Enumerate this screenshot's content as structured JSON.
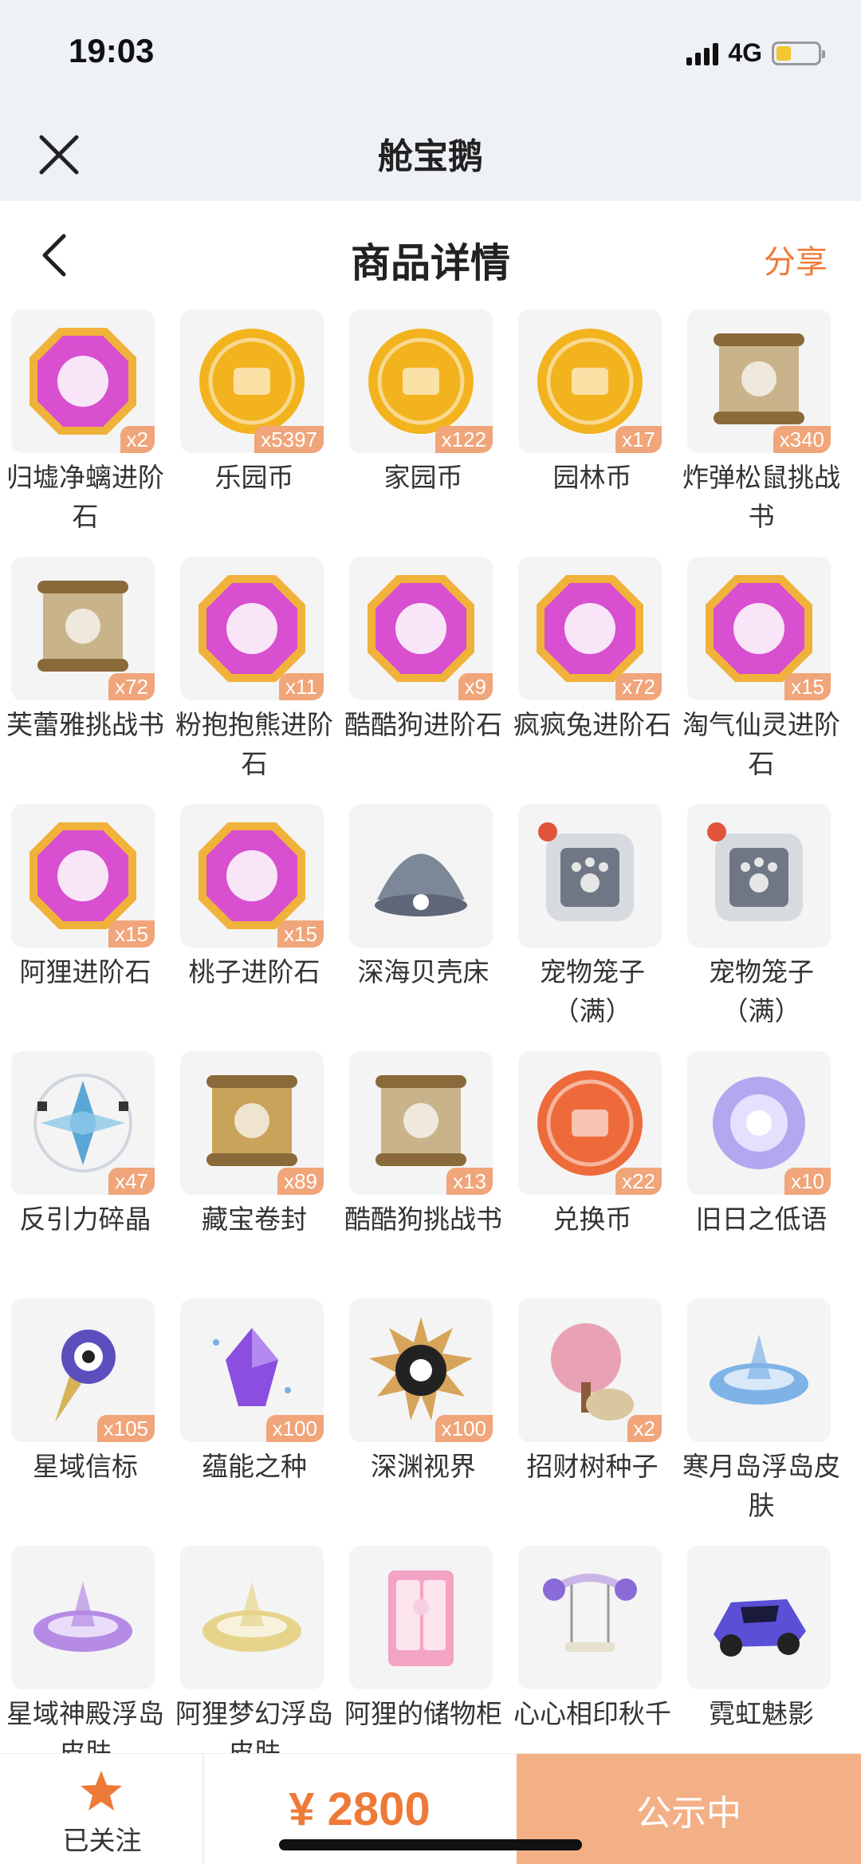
{
  "status": {
    "time": "19:03",
    "network": "4G"
  },
  "app": {
    "title": "舱宝鹅"
  },
  "page": {
    "title": "商品详情",
    "share": "分享"
  },
  "items": [
    {
      "name": "归墟净螭进阶石",
      "qty": "x2",
      "icon": "gem-icon",
      "color": "#d84fd0"
    },
    {
      "name": "乐园币",
      "qty": "x5397",
      "icon": "coin-icon",
      "color": "#f2b31f"
    },
    {
      "name": "家园币",
      "qty": "x122",
      "icon": "coin-icon",
      "color": "#f2b31f"
    },
    {
      "name": "园林币",
      "qty": "x17",
      "icon": "coin-icon",
      "color": "#f2b31f"
    },
    {
      "name": "炸弹松鼠挑战书",
      "qty": "x340",
      "icon": "scroll-icon",
      "color": "#c9b38a"
    },
    {
      "name": "芙蕾雅挑战书",
      "qty": "x72",
      "icon": "scroll-icon",
      "color": "#c9b38a"
    },
    {
      "name": "粉抱抱熊进阶石",
      "qty": "x11",
      "icon": "gem-icon",
      "color": "#d84fd0"
    },
    {
      "name": "酷酷狗进阶石",
      "qty": "x9",
      "icon": "gem-icon",
      "color": "#d84fd0"
    },
    {
      "name": "疯疯兔进阶石",
      "qty": "x72",
      "icon": "gem-icon",
      "color": "#d84fd0"
    },
    {
      "name": "淘气仙灵进阶石",
      "qty": "x15",
      "icon": "gem-icon",
      "color": "#d84fd0"
    },
    {
      "name": "阿狸进阶石",
      "qty": "x15",
      "icon": "gem-icon",
      "color": "#d84fd0"
    },
    {
      "name": "桃子进阶石",
      "qty": "x15",
      "icon": "gem-icon",
      "color": "#d84fd0"
    },
    {
      "name": "深海贝壳床",
      "qty": "",
      "icon": "shell-icon",
      "color": "#7c8797"
    },
    {
      "name": "宠物笼子（满）",
      "qty": "",
      "icon": "cage-icon",
      "color": "#6f7784"
    },
    {
      "name": "宠物笼子（满）",
      "qty": "",
      "icon": "cage-icon",
      "color": "#6f7784"
    },
    {
      "name": "反引力碎晶",
      "qty": "x47",
      "icon": "crystal-icon",
      "color": "#5aa6d6"
    },
    {
      "name": "藏宝卷封",
      "qty": "x89",
      "icon": "scroll-icon",
      "color": "#c9a35a"
    },
    {
      "name": "酷酷狗挑战书",
      "qty": "x13",
      "icon": "scroll-icon",
      "color": "#c9b38a"
    },
    {
      "name": "兑换币",
      "qty": "x22",
      "icon": "coin-icon",
      "color": "#ee6a3a"
    },
    {
      "name": "旧日之低语",
      "qty": "x10",
      "icon": "orb-icon",
      "color": "#b5a6f0"
    },
    {
      "name": "星域信标",
      "qty": "x105",
      "icon": "beacon-icon",
      "color": "#5b4fbe"
    },
    {
      "name": "蕴能之种",
      "qty": "x100",
      "icon": "seed-icon",
      "color": "#8a4fe0"
    },
    {
      "name": "深渊视界",
      "qty": "x100",
      "icon": "sun-icon",
      "color": "#d6a45a"
    },
    {
      "name": "招财树种子",
      "qty": "x2",
      "icon": "tree-icon",
      "color": "#e8a2b4"
    },
    {
      "name": "寒月岛浮岛皮肤",
      "qty": "",
      "icon": "island-icon",
      "color": "#7fb3e6"
    },
    {
      "name": "星域神殿浮岛皮肤",
      "qty": "",
      "icon": "island-icon",
      "color": "#b58be6"
    },
    {
      "name": "阿狸梦幻浮岛皮肤",
      "qty": "",
      "icon": "island-icon",
      "color": "#e6d48b"
    },
    {
      "name": "阿狸的储物柜",
      "qty": "",
      "icon": "cabinet-icon",
      "color": "#f3a3c4"
    },
    {
      "name": "心心相印秋千",
      "qty": "",
      "icon": "swing-icon",
      "color": "#c9b6e6"
    },
    {
      "name": "霓虹魅影",
      "qty": "",
      "icon": "car-icon",
      "color": "#5a4fd6"
    }
  ],
  "bottom": {
    "follow": "已关注",
    "price": "¥ 2800",
    "status": "公示中"
  }
}
